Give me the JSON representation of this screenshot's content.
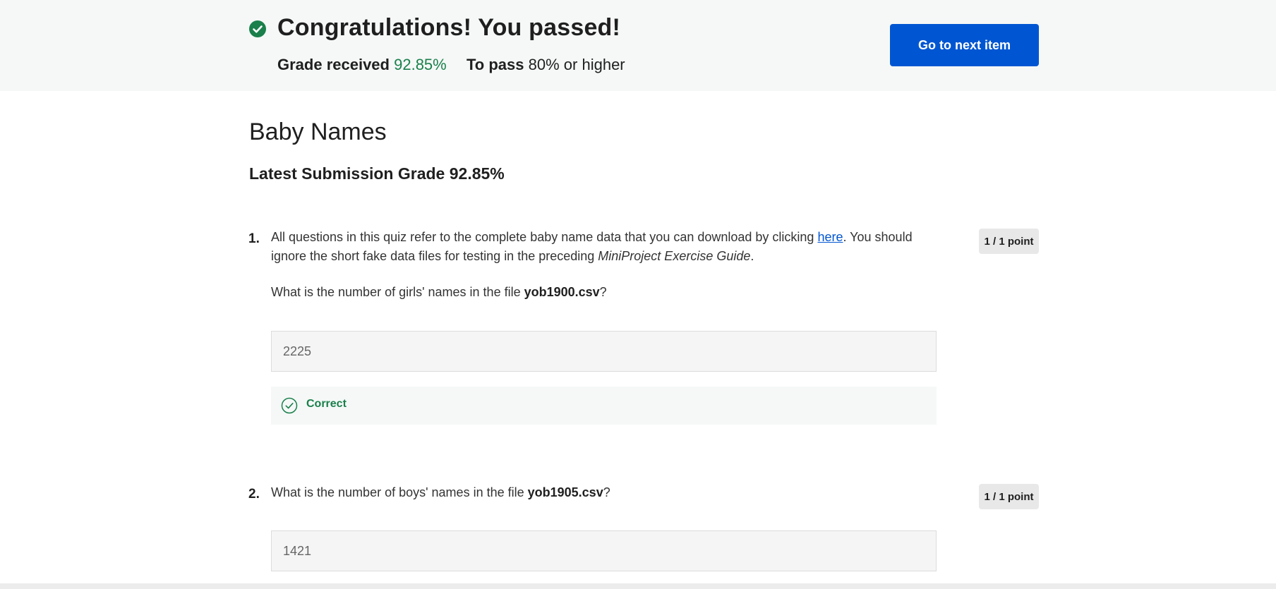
{
  "banner": {
    "title": "Congratulations! You passed!",
    "grade_label": "Grade received",
    "grade_value": "92.85%",
    "pass_label": "To pass",
    "pass_value": "80%",
    "pass_suffix": "or higher",
    "next_button": "Go to next item",
    "icon": "check-circle-icon"
  },
  "quiz": {
    "title": "Baby Names",
    "latest_grade": "Latest Submission Grade 92.85%"
  },
  "questions": [
    {
      "number": "1.",
      "points": "1 / 1 point",
      "text_before_link": "All questions in this quiz refer to the complete baby name data that you can download by clicking ",
      "link": "here",
      "text_after_link": ". You should ignore the short fake data files for testing in the preceding ",
      "guide": "MiniProject Exercise Guide",
      "text_end": ".",
      "prompt_before": "What is the number of girls' names in the file ",
      "prompt_file": "yob1900.csv",
      "prompt_after": "?",
      "answer": "2225",
      "feedback": "Correct"
    },
    {
      "number": "2.",
      "points": "1 / 1 point",
      "prompt_before": "What is the number of boys' names in the file ",
      "prompt_file": "yob1905.csv",
      "prompt_after": "?",
      "answer": "1421"
    }
  ],
  "colors": {
    "accent": "#0056d2",
    "success": "#1a7f4b",
    "banner_bg": "#f5f8f7"
  }
}
